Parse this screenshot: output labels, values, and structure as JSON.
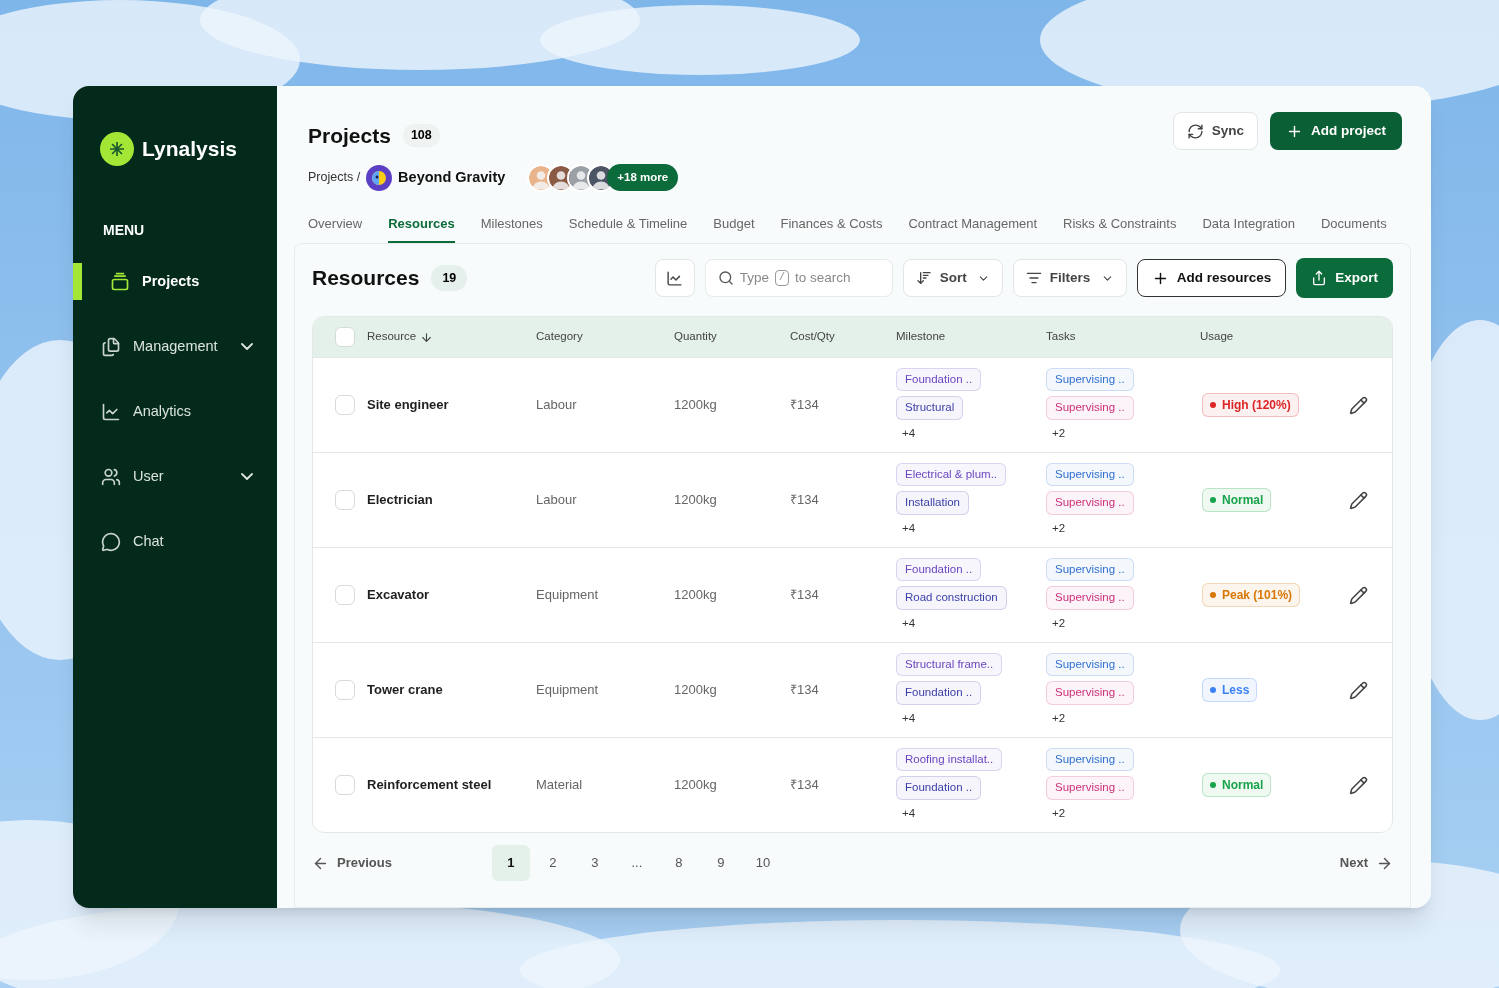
{
  "brand": {
    "name": "Lynalysis"
  },
  "sidebar": {
    "heading": "MENU",
    "items": [
      {
        "label": "Projects",
        "kind": "projects",
        "selected": true,
        "has_submenu": false
      },
      {
        "label": "Management",
        "kind": "management",
        "selected": false,
        "has_submenu": true
      },
      {
        "label": "Analytics",
        "kind": "analytics",
        "selected": false,
        "has_submenu": false
      },
      {
        "label": "User",
        "kind": "user",
        "selected": false,
        "has_submenu": true
      },
      {
        "label": "Chat",
        "kind": "chat",
        "selected": false,
        "has_submenu": false
      }
    ]
  },
  "header": {
    "title": "Projects",
    "count": "108",
    "sync": "Sync",
    "add": "Add project"
  },
  "breadcrumb": {
    "root": "Projects /",
    "project": "Beyond Gravity",
    "avatars": [
      {
        "color": "#e9b48c"
      },
      {
        "color": "#8a5a44"
      },
      {
        "color": "#9aa0a6"
      },
      {
        "color": "#4b5563"
      }
    ],
    "more": "+18 more"
  },
  "tabs": [
    {
      "label": "Overview",
      "selected": false
    },
    {
      "label": "Resources",
      "selected": true
    },
    {
      "label": "Milestones",
      "selected": false
    },
    {
      "label": "Schedule & Timeline",
      "selected": false
    },
    {
      "label": "Budget",
      "selected": false
    },
    {
      "label": "Finances & Costs",
      "selected": false
    },
    {
      "label": "Contract Management",
      "selected": false
    },
    {
      "label": "Risks & Constraints",
      "selected": false
    },
    {
      "label": "Data Integration",
      "selected": false
    },
    {
      "label": "Documents",
      "selected": false
    }
  ],
  "resources": {
    "title": "Resources",
    "count": "19",
    "search": {
      "before": "Type",
      "key": "/",
      "after": "to search"
    },
    "sort": "Sort",
    "filters": "Filters",
    "add": "Add resources",
    "export": "Export"
  },
  "table": {
    "columns": [
      "Resource",
      "Category",
      "Quantity",
      "Cost/Qty",
      "Milestone",
      "Tasks",
      "Usage"
    ],
    "all_checked": false,
    "rows": [
      {
        "checked": false,
        "resource": "Site engineer",
        "category": "Labour",
        "quantity": "1200kg",
        "cost": "₹134",
        "milestones": [
          {
            "label": "Foundation ..",
            "color": "#6b46c1"
          },
          {
            "label": "Structural",
            "color": "#3b3fa8"
          }
        ],
        "milestones_more": "+4",
        "tasks": [
          {
            "label": "Supervising ..",
            "color": "#2f6fd0"
          },
          {
            "label": "Supervising ..",
            "color": "#cc2f7a"
          }
        ],
        "tasks_more": "+2",
        "usage": {
          "label": "High (120%)",
          "color": "#dc2626"
        }
      },
      {
        "checked": false,
        "resource": "Electrician",
        "category": "Labour",
        "quantity": "1200kg",
        "cost": "₹134",
        "milestones": [
          {
            "label": "Electrical & plum..",
            "color": "#6b46c1"
          },
          {
            "label": "Installation",
            "color": "#3b3fa8"
          }
        ],
        "milestones_more": "+4",
        "tasks": [
          {
            "label": "Supervising ..",
            "color": "#2f6fd0"
          },
          {
            "label": "Supervising ..",
            "color": "#cc2f7a"
          }
        ],
        "tasks_more": "+2",
        "usage": {
          "label": "Normal",
          "color": "#16a34a"
        }
      },
      {
        "checked": false,
        "resource": "Excavator",
        "category": "Equipment",
        "quantity": "1200kg",
        "cost": "₹134",
        "milestones": [
          {
            "label": "Foundation ..",
            "color": "#6b46c1"
          },
          {
            "label": "Road construction",
            "color": "#3b3fa8"
          }
        ],
        "milestones_more": "+4",
        "tasks": [
          {
            "label": "Supervising ..",
            "color": "#2f6fd0"
          },
          {
            "label": "Supervising ..",
            "color": "#cc2f7a"
          }
        ],
        "tasks_more": "+2",
        "usage": {
          "label": "Peak (101%)",
          "color": "#d97706"
        }
      },
      {
        "checked": false,
        "resource": "Tower crane",
        "category": "Equipment",
        "quantity": "1200kg",
        "cost": "₹134",
        "milestones": [
          {
            "label": "Structural frame..",
            "color": "#6b46c1"
          },
          {
            "label": "Foundation ..",
            "color": "#3b3fa8"
          }
        ],
        "milestones_more": "+4",
        "tasks": [
          {
            "label": "Supervising ..",
            "color": "#2f6fd0"
          },
          {
            "label": "Supervising ..",
            "color": "#cc2f7a"
          }
        ],
        "tasks_more": "+2",
        "usage": {
          "label": "Less",
          "color": "#3b82f6"
        }
      },
      {
        "checked": false,
        "resource": "Reinforcement steel",
        "category": "Material",
        "quantity": "1200kg",
        "cost": "₹134",
        "milestones": [
          {
            "label": "Roofing installat..",
            "color": "#6b46c1"
          },
          {
            "label": "Foundation ..",
            "color": "#3b3fa8"
          }
        ],
        "milestones_more": "+4",
        "tasks": [
          {
            "label": "Supervising ..",
            "color": "#2f6fd0"
          },
          {
            "label": "Supervising ..",
            "color": "#cc2f7a"
          }
        ],
        "tasks_more": "+2",
        "usage": {
          "label": "Normal",
          "color": "#16a34a"
        }
      }
    ]
  },
  "pagination": {
    "previous": "Previous",
    "next": "Next",
    "pages": [
      {
        "label": "1",
        "selected": true
      },
      {
        "label": "2",
        "selected": false
      },
      {
        "label": "3",
        "selected": false
      },
      {
        "label": "...",
        "selected": false
      },
      {
        "label": "8",
        "selected": false
      },
      {
        "label": "9",
        "selected": false
      },
      {
        "label": "10",
        "selected": false
      }
    ]
  }
}
